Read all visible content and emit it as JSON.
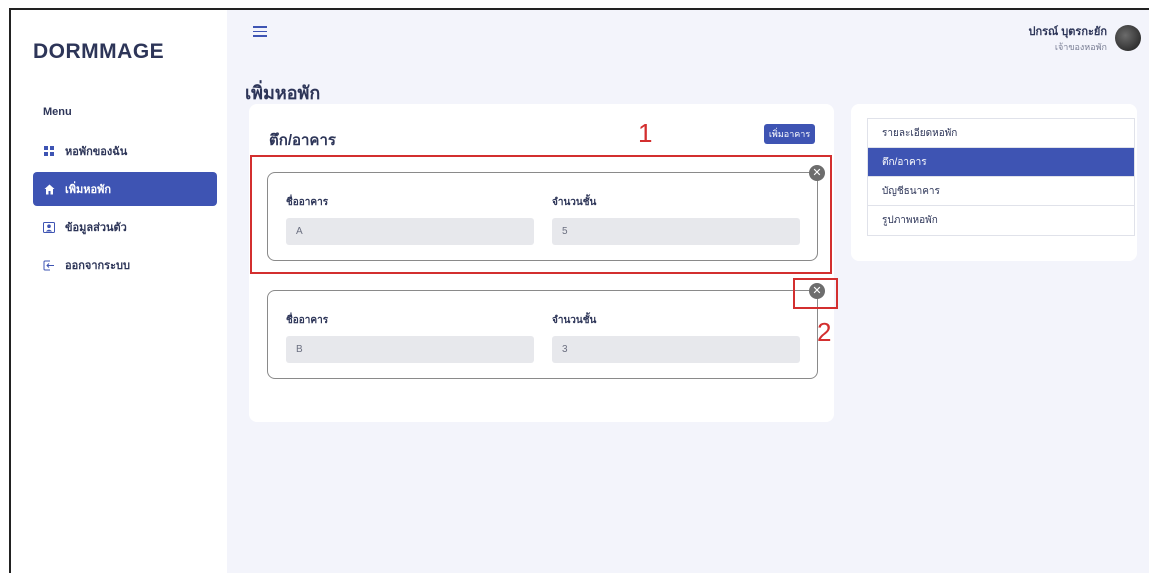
{
  "app": {
    "logo": "DORMMAGE"
  },
  "sidebar": {
    "menu_title": "Menu",
    "items": [
      {
        "label": "หอพักของฉัน",
        "icon": "grid-icon",
        "active": false
      },
      {
        "label": "เพิ่มหอพัก",
        "icon": "home-icon",
        "active": true
      },
      {
        "label": "ข้อมูลส่วนตัว",
        "icon": "user-card-icon",
        "active": false
      },
      {
        "label": "ออกจากระบบ",
        "icon": "logout-icon",
        "active": false
      }
    ]
  },
  "header": {
    "user_name": "ปกรณ์ บุตรกะยัก",
    "user_role": "เจ้าของหอพัก"
  },
  "page": {
    "title": "เพิ่มหอพัก"
  },
  "building_card": {
    "title": "ตึก/อาคาร",
    "add_button": "เพิ่มอาคาร",
    "buildings": [
      {
        "name_label": "ชื่ออาคาร",
        "floors_label": "จำนวนชั้น",
        "name_value": "A",
        "floors_value": "5"
      },
      {
        "name_label": "ชื่ออาคาร",
        "floors_label": "จำนวนชั้น",
        "name_value": "B",
        "floors_value": "3"
      }
    ]
  },
  "side_nav": {
    "items": [
      {
        "label": "รายละเอียดหอพัก",
        "active": false
      },
      {
        "label": "ตึก/อาคาร",
        "active": true
      },
      {
        "label": "บัญชีธนาคาร",
        "active": false
      },
      {
        "label": "รูปภาพหอพัก",
        "active": false
      }
    ]
  },
  "annotations": {
    "one": "1",
    "two": "2"
  },
  "colors": {
    "accent": "#3e54b3",
    "annotation": "#d32f2f",
    "background": "#f3f4fb"
  }
}
